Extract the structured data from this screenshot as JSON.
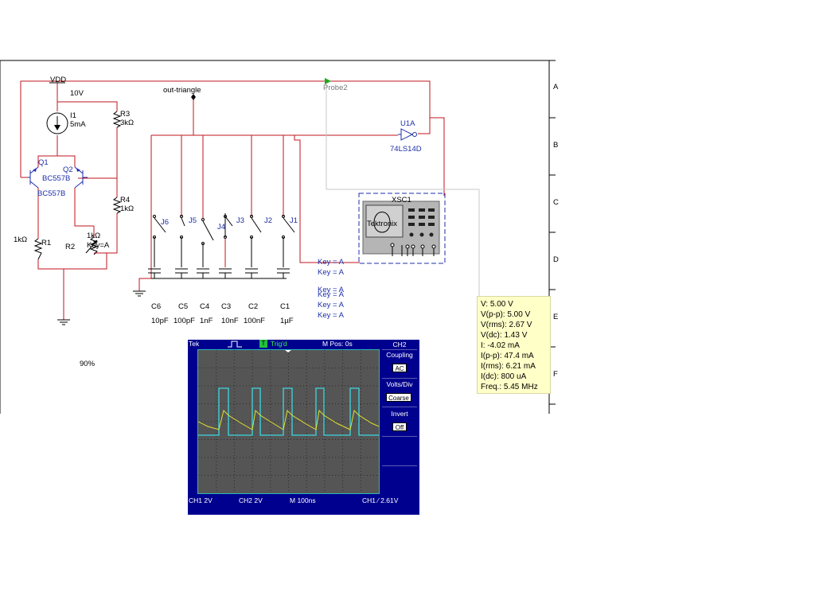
{
  "schematic": {
    "vdd_label": "VDD",
    "vdd_value": "10V",
    "out_label": "out-triangle",
    "probe_label": "Probe2",
    "current_source": {
      "ref": "I1",
      "value": "5mA"
    },
    "r3": {
      "ref": "R3",
      "value": "3kΩ"
    },
    "r4": {
      "ref": "R4",
      "value": "1kΩ"
    },
    "r1": {
      "ref": "R1",
      "value": "1kΩ"
    },
    "r2": {
      "ref": "R2",
      "value": "1kΩ",
      "key": "Key=A",
      "percent": "90%"
    },
    "q1": {
      "ref": "Q1",
      "model": "BC557B"
    },
    "q2": {
      "ref": "Q2",
      "model": "BC557B"
    },
    "u1a": {
      "ref": "U1A",
      "model": "74LS14D"
    },
    "xsc1": {
      "ref": "XSC1",
      "brand": "Tektronix"
    },
    "switches": [
      "J6",
      "J5",
      "J4",
      "J3",
      "J2",
      "J1"
    ],
    "capacitors": [
      {
        "ref": "C6",
        "value": "10pF"
      },
      {
        "ref": "C5",
        "value": "100pF"
      },
      {
        "ref": "C4",
        "value": "1nF"
      },
      {
        "ref": "C3",
        "value": "10nF"
      },
      {
        "ref": "C2",
        "value": "100nF"
      },
      {
        "ref": "C1",
        "value": "1µF"
      }
    ],
    "key_labels": [
      "Key = A",
      "Key = A",
      "Key = A",
      "Key = A",
      "Key = A",
      "Key = A"
    ],
    "border_letters": [
      "A",
      "B",
      "C",
      "D",
      "E",
      "F"
    ]
  },
  "probe": {
    "lines": [
      "V: 5.00 V",
      "V(p-p): 5.00 V",
      "V(rms): 2.67 V",
      "V(dc): 1.43 V",
      "I: -4.02 mA",
      "I(p-p): 47.4 mA",
      "I(rms): 6.21 mA",
      "I(dc): 800 uA",
      "Freq.: 5.45 MHz"
    ]
  },
  "scope": {
    "brand": "Tek",
    "trigger_state": "Trig'd",
    "trigger_badge": "T",
    "mpos": "M Pos: 0s",
    "channel": "CH2",
    "coupling_label": "Coupling",
    "coupling_value": "AC",
    "volts_label": "Volts/Div",
    "volts_value": "Coarse",
    "invert_label": "Invert",
    "invert_value": "Off",
    "ch1": "CH1 2V",
    "ch2": "CH2 2V",
    "timebase": "M 100ns",
    "trigger_level": "CH1 ∕ 2.61V",
    "colors": {
      "background": "#00008e",
      "grid": "#555555",
      "ch1_trace": "#e0e030",
      "ch2_trace": "#3cd8e0"
    }
  }
}
